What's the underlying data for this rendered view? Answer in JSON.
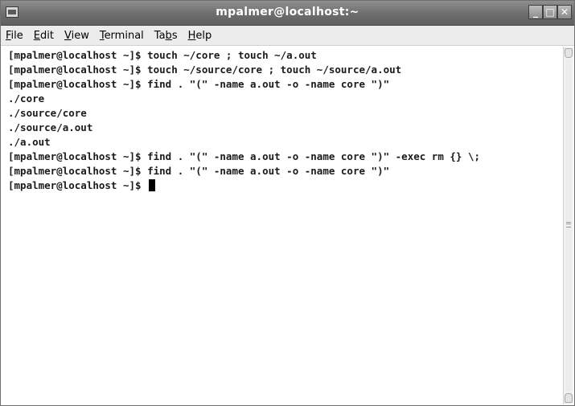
{
  "window": {
    "title": "mpalmer@localhost:~",
    "controls": {
      "minimize": "_",
      "maximize": "□",
      "close": "✕"
    }
  },
  "menu": {
    "items": [
      {
        "label": "File",
        "mnemonic": "F",
        "rest": "ile"
      },
      {
        "label": "Edit",
        "mnemonic": "E",
        "rest": "dit"
      },
      {
        "label": "View",
        "mnemonic": "V",
        "rest": "iew"
      },
      {
        "label": "Terminal",
        "mnemonic": "T",
        "rest": "erminal"
      },
      {
        "label": "Tabs",
        "pre": "Ta",
        "mnemonic": "b",
        "rest": "s"
      },
      {
        "label": "Help",
        "mnemonic": "H",
        "rest": "elp"
      }
    ]
  },
  "terminal": {
    "lines": [
      "[mpalmer@localhost ~]$ touch ~/core ; touch ~/a.out",
      "[mpalmer@localhost ~]$ touch ~/source/core ; touch ~/source/a.out",
      "[mpalmer@localhost ~]$ find . \"(\" -name a.out -o -name core \")\"",
      "./core",
      "./source/core",
      "./source/a.out",
      "./a.out",
      "[mpalmer@localhost ~]$ find . \"(\" -name a.out -o -name core \")\" -exec rm {} \\;",
      "[mpalmer@localhost ~]$ find . \"(\" -name a.out -o -name core \")\"",
      "[mpalmer@localhost ~]$ "
    ]
  }
}
